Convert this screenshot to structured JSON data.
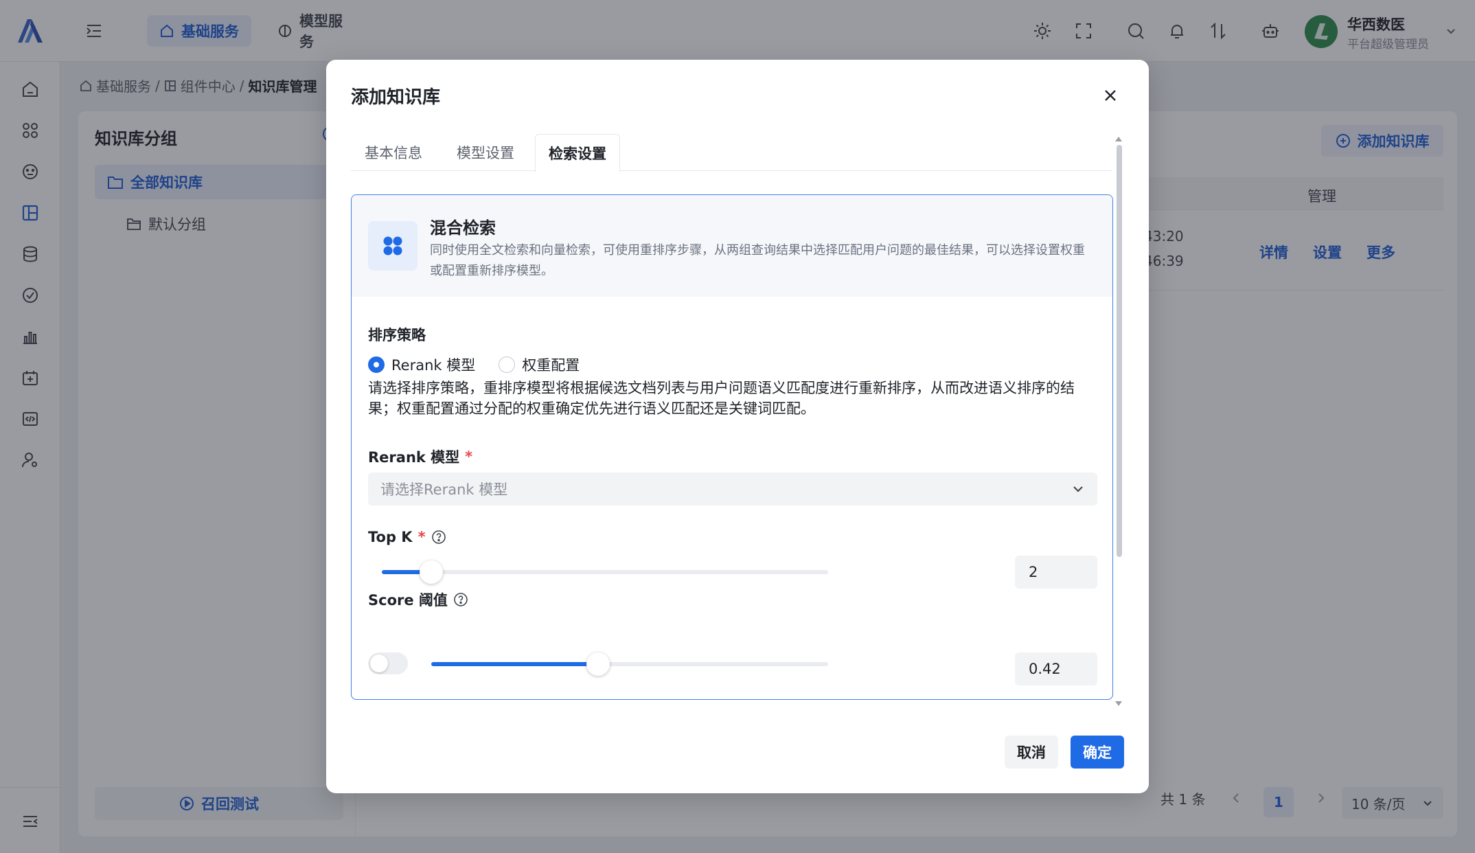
{
  "colors": {
    "accent": "#1f6be6",
    "accent_soft": "#e9effb",
    "required": "#e5484d",
    "text_primary": "#1f2329",
    "text_secondary": "#6b7280"
  },
  "topbar": {
    "logo_icon": "brand-logo-icon",
    "menu_toggle_icon": "menu-indent-icon",
    "tabs": [
      {
        "label": "基础服务",
        "icon": "home-icon",
        "active": true
      },
      {
        "label": "模型服务",
        "icon": "brain-icon",
        "active": false
      }
    ],
    "actions": [
      "sun-icon",
      "fullscreen-icon",
      "search-icon",
      "bell-icon",
      "sort-arrows-icon",
      "robot-icon"
    ],
    "user": {
      "name": "华西数医",
      "role": "平台超级管理员"
    }
  },
  "leftnav": {
    "items": [
      "home-icon",
      "apps-icon",
      "dashboard-icon",
      "layout-icon",
      "database-icon",
      "check-circle-icon",
      "bar-chart-icon",
      "calendar-add-icon",
      "code-icon",
      "user-setting-icon"
    ],
    "collapse_icon": "collapse-menu-icon"
  },
  "breadcrumb": {
    "items": [
      "基础服务",
      "组件中心"
    ],
    "current": "知识库管理",
    "separator": "/"
  },
  "groups": {
    "title": "知识库分组",
    "all_label": "全部知识库",
    "default_label": "默认分组",
    "recall_label": "召回测试"
  },
  "list": {
    "add_label": "添加知识库",
    "manage_header": "管理",
    "row": {
      "time1": "43:20",
      "time2": "46:39",
      "actions": [
        "详情",
        "设置",
        "更多"
      ]
    },
    "pagination": {
      "total": "共 1 条",
      "page": "1",
      "page_size": "10 条/页"
    }
  },
  "modal": {
    "title": "添加知识库",
    "tabs": [
      {
        "label": "基本信息",
        "active": false
      },
      {
        "label": "模型设置",
        "active": false
      },
      {
        "label": "检索设置",
        "active": true
      }
    ],
    "section": {
      "title": "混合检索",
      "icon": "grid-dots-icon",
      "description": "同时使用全文检索和向量检索，可使用重排序步骤，从两组查询结果中选择匹配用户问题的最佳结果，可以选择设置权重或配置重新排序模型。"
    },
    "strategy": {
      "label": "排序策略",
      "options": [
        {
          "label": "Rerank 模型",
          "checked": true
        },
        {
          "label": "权重配置",
          "checked": false
        }
      ],
      "help": "请选择排序策略，重排序模型将根据候选文档列表与用户问题语义匹配度进行重新排序，从而改进语义排序的结果；权重配置通过分配的权重确定优先进行语义匹配还是关键词匹配。"
    },
    "rerank": {
      "label": "Rerank 模型",
      "required_mark": "*",
      "placeholder": "请选择Rerank 模型"
    },
    "topk": {
      "label": "Top K",
      "required_mark": "*",
      "value": "2",
      "slider_fraction": 0.11
    },
    "score": {
      "label": "Score 阈值",
      "value": "0.42",
      "slider_fraction": 0.42,
      "enabled": false
    },
    "footer": {
      "cancel_label": "取消",
      "ok_label": "确定"
    }
  }
}
